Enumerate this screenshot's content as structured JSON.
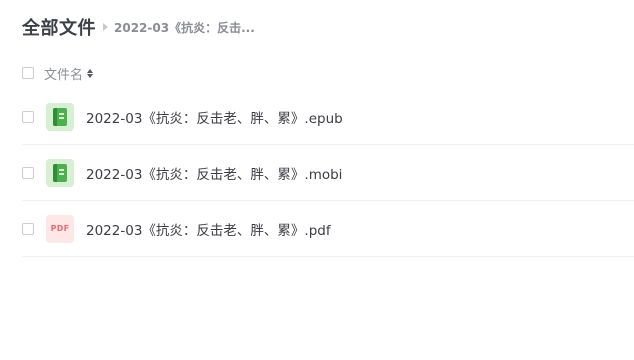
{
  "header": {
    "root_title": "全部文件",
    "current_folder": "2022-03《抗炎：反击..."
  },
  "list_header": {
    "column_name": "文件名"
  },
  "files": [
    {
      "name": "2022-03《抗炎：反击老、胖、累》.epub",
      "icon": "ebook-icon"
    },
    {
      "name": "2022-03《抗炎：反击老、胖、累》.mobi",
      "icon": "ebook-icon"
    },
    {
      "name": "2022-03《抗炎：反击老、胖、累》.pdf",
      "icon": "pdf-icon",
      "icon_text": "PDF"
    }
  ],
  "colors": {
    "ebook_icon_bg": "#d7f0d4",
    "ebook_icon_fg": "#4caf50",
    "pdf_icon_bg": "#fde7e7",
    "pdf_icon_fg": "#f26a6a",
    "row_divider": "#f1f2f4"
  }
}
